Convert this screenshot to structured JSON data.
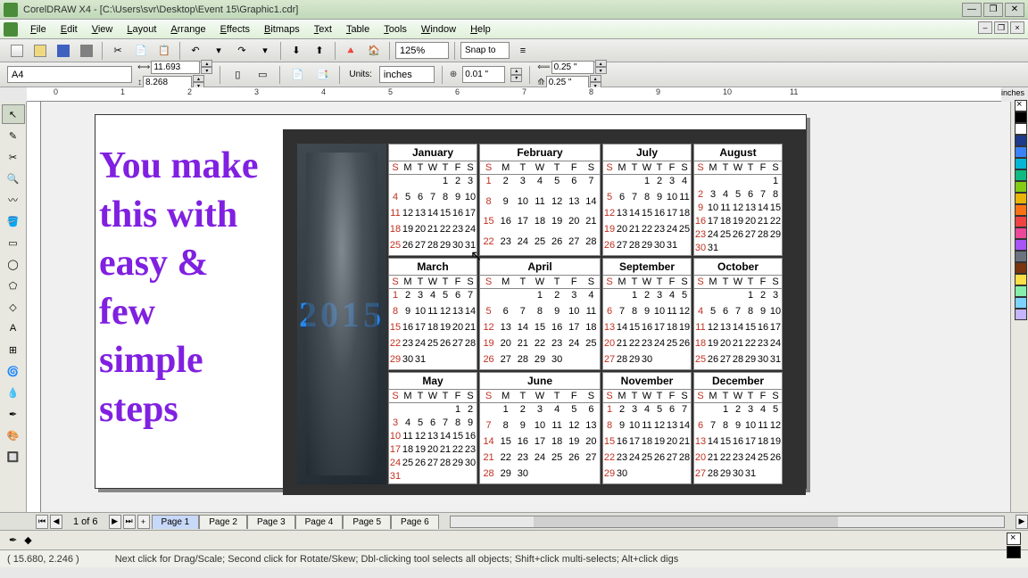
{
  "app": {
    "title": "CorelDRAW X4 - [C:\\Users\\svr\\Desktop\\Event 15\\Graphic1.cdr]"
  },
  "menu": [
    "File",
    "Edit",
    "View",
    "Layout",
    "Arrange",
    "Effects",
    "Bitmaps",
    "Text",
    "Table",
    "Tools",
    "Window",
    "Help"
  ],
  "toolbar1": {
    "zoom": "125%",
    "snap_label": "Snap to"
  },
  "toolbar2": {
    "paper": "A4",
    "width": "11.693",
    "height": "8.268",
    "units_label": "Units:",
    "units": "inches",
    "nudge": "0.01 \"",
    "dup_x": "0.25 \"",
    "dup_y": "0.25 \""
  },
  "ruler": {
    "unit_label": "inches",
    "ticks_h": [
      "0",
      "1",
      "2",
      "3",
      "4",
      "5",
      "6",
      "7",
      "8",
      "9",
      "10",
      "11"
    ]
  },
  "canvas": {
    "decorative_text": "You make this with easy & few simple steps",
    "year": "2015",
    "day_headers": [
      "S",
      "M",
      "T",
      "W",
      "T",
      "F",
      "S"
    ],
    "months": [
      {
        "name": "January",
        "start": 4,
        "days": 31
      },
      {
        "name": "February",
        "start": 0,
        "days": 28
      },
      {
        "name": "March",
        "start": 0,
        "days": 31
      },
      {
        "name": "April",
        "start": 3,
        "days": 30
      },
      {
        "name": "May",
        "start": 5,
        "days": 31
      },
      {
        "name": "June",
        "start": 1,
        "days": 30
      },
      {
        "name": "July",
        "start": 3,
        "days": 31
      },
      {
        "name": "August",
        "start": 6,
        "days": 31
      },
      {
        "name": "September",
        "start": 2,
        "days": 30
      },
      {
        "name": "October",
        "start": 4,
        "days": 31
      },
      {
        "name": "November",
        "start": 0,
        "days": 30
      },
      {
        "name": "December",
        "start": 2,
        "days": 31
      }
    ]
  },
  "pages": {
    "count_label": "1 of 6",
    "tabs": [
      "Page 1",
      "Page 2",
      "Page 3",
      "Page 4",
      "Page 5",
      "Page 6"
    ],
    "active": 0
  },
  "status": {
    "coords": "( 15.680, 2.246 )",
    "hint": "Next click for Drag/Scale; Second click for Rotate/Skew; Dbl-clicking tool selects all objects; Shift+click multi-selects; Alt+click digs"
  },
  "palette": [
    "#000000",
    "#ffffff",
    "#1e3a8a",
    "#3b82f6",
    "#06b6d4",
    "#10b981",
    "#84cc16",
    "#eab308",
    "#f97316",
    "#ef4444",
    "#ec4899",
    "#a855f7",
    "#6b7280",
    "#78350f",
    "#fde047",
    "#86efac",
    "#7dd3fc",
    "#c4b5fd"
  ]
}
